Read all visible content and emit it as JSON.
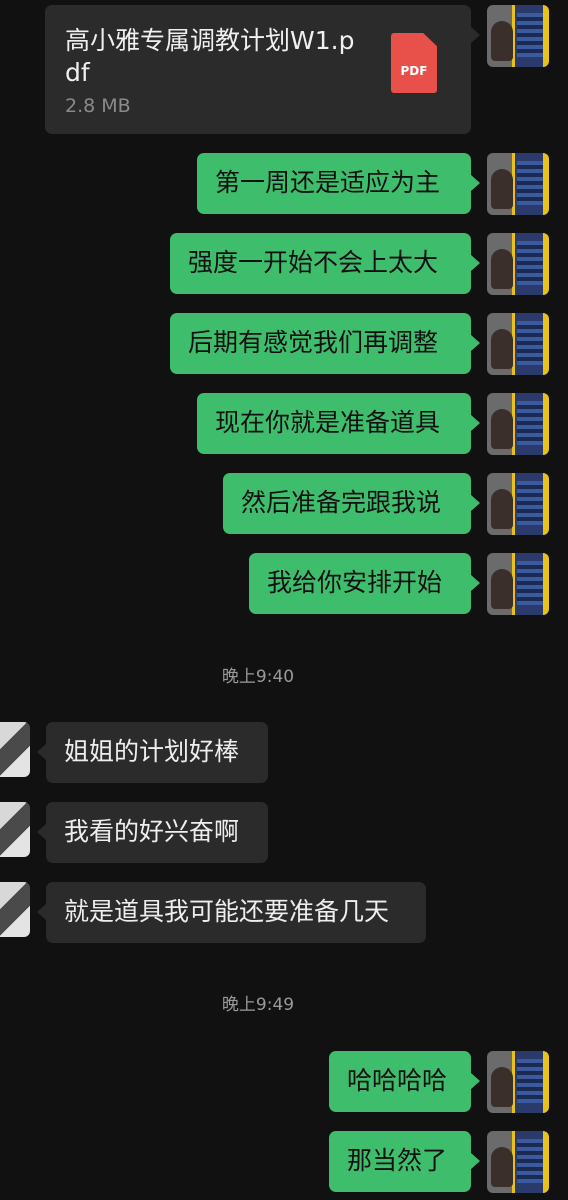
{
  "file_message": {
    "file_name": "高小雅专属调教计划W1.pdf",
    "file_size": "2.8 MB",
    "file_type_label": "PDF",
    "file_icon_color": "#e8504a"
  },
  "timestamps": [
    "晚上9:40",
    "晚上9:49"
  ],
  "messages_block_1": [
    "第一周还是适应为主",
    "强度一开始不会上太大",
    "后期有感觉我们再调整",
    "现在你就是准备道具",
    "然后准备完跟我说",
    "我给你安排开始"
  ],
  "messages_block_2": [
    "姐姐的计划好棒",
    "我看的好兴奋啊",
    "就是道具我可能还要准备几天"
  ],
  "messages_block_3": [
    "哈哈哈哈",
    "那当然了"
  ],
  "colors": {
    "background": "#111111",
    "outgoing_bubble": "#3ebd6d",
    "incoming_bubble": "#2b2b2b",
    "timestamp_text": "#9a9a9a"
  }
}
